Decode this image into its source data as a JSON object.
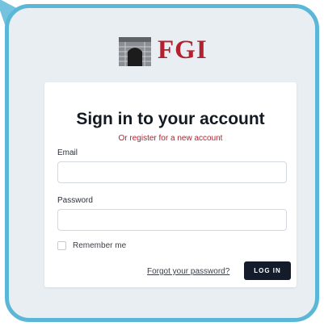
{
  "brand": {
    "logo_text": "FGI",
    "colors": {
      "accent": "#b3202f",
      "frame": "#5bb7d8",
      "button": "#141c2b"
    }
  },
  "login": {
    "title": "Sign in to your account",
    "subtitle_prefix": "Or",
    "register_link": "register for a new account",
    "email_label": "Email",
    "email_value": "",
    "password_label": "Password",
    "password_value": "",
    "remember_label": "Remember me",
    "forgot_link": "Forgot your password?",
    "login_button": "LOG IN"
  }
}
